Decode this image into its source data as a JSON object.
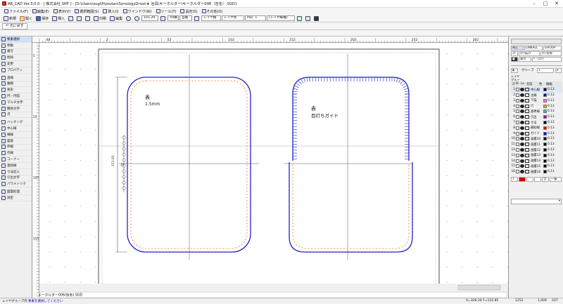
{
  "window": {
    "title": "AR_CAD Ver.3.0.0 - [ 株式会社 SHF ] - [D:\\Users\\sugi\\Hyoutan\\SynologyDrive\\★ 治具\\キーホルダー\\キーホルダー006（缶缶）.SGD]",
    "controls": [
      "–",
      "□",
      "✕"
    ]
  },
  "menubar": [
    {
      "label": "ファイル(F)",
      "icon": "file-icon"
    },
    {
      "label": "編集(E)",
      "icon": "edit-icon"
    },
    {
      "label": "表示(V)",
      "icon": "view-icon"
    },
    {
      "label": "選択範囲(S)",
      "icon": "select-icon"
    },
    {
      "label": "挿入(I)",
      "icon": "insert-icon"
    },
    {
      "label": "ウインドウ(W)",
      "icon": "window-icon"
    },
    {
      "label": "ツール(T)",
      "icon": "tool-icon"
    },
    {
      "label": "設定(S)",
      "icon": "settings-icon"
    },
    {
      "label": "その他(O)",
      "icon": "other-icon"
    }
  ],
  "toolbar": {
    "buttons": [
      "新規",
      "開く",
      "保存",
      "挿入",
      "印刷",
      "編集"
    ],
    "zoom": "101.29",
    "paper": "A4横",
    "mode": "自動",
    "layer_dropdown": "レイヤ幅",
    "color_dropdown": "レイヤ色",
    "pen_dropdown": "Pen. 1",
    "line_dropdown": "[レイヤ線種]"
  },
  "undo_label": "元に戻す",
  "leftpanel": [
    {
      "label": "要素選択",
      "icon": "cursor-icon",
      "selected": true
    },
    {
      "label": "移動",
      "icon": "move-icon"
    },
    {
      "label": "複写",
      "icon": "copy-icon"
    },
    {
      "label": "削除",
      "icon": "delete-icon"
    },
    {
      "label": "変更",
      "icon": "change-icon"
    },
    {
      "label": "プロパティ",
      "icon": "property-icon"
    },
    {
      "label": "直線",
      "icon": "line-icon"
    },
    {
      "label": "曲線",
      "icon": "curve-icon"
    },
    {
      "label": "矩形",
      "icon": "rect-icon"
    },
    {
      "label": "円・円弧",
      "icon": "circle-icon"
    },
    {
      "label": "マルチ文字",
      "icon": "multitext-icon"
    },
    {
      "label": "簡易文字",
      "icon": "text-icon"
    },
    {
      "label": "点",
      "icon": "point-icon"
    },
    {
      "label": "ハッチング",
      "icon": "hatch-icon"
    },
    {
      "label": "中心線",
      "icon": "centerline-icon"
    },
    {
      "label": "補線",
      "icon": "auxline-icon"
    },
    {
      "label": "面取",
      "icon": "chamfer-icon"
    },
    {
      "label": "伸縮",
      "icon": "stretch-icon"
    },
    {
      "label": "作線",
      "icon": "drawline-icon"
    },
    {
      "label": "コーナー",
      "icon": "corner-icon"
    },
    {
      "label": "連続線",
      "icon": "polyline-icon"
    },
    {
      "label": "寸法記入",
      "icon": "dimension-icon"
    },
    {
      "label": "引出文字",
      "icon": "leader-icon"
    },
    {
      "label": "パラメトリク",
      "icon": "parametric-icon"
    },
    {
      "label": "図面処理",
      "icon": "process-icon"
    },
    {
      "label": "測定",
      "icon": "measure-icon"
    }
  ],
  "rulers": {
    "h": [
      "-48",
      "2",
      "52",
      "102",
      "152",
      "202",
      "252",
      "302"
    ],
    "v": [
      "5",
      "55",
      "105",
      "155",
      "205"
    ]
  },
  "drawing": {
    "left_label_1": "表",
    "left_label_2": "1.5mm",
    "right_label_1": "表",
    "right_label_2": "目打ちガイド",
    "dim_height": "151.81",
    "dim_small": "35"
  },
  "filetab": "キーホルダー006(缶缶).SGD",
  "rightpanel": {
    "tabs": [
      "ALL",
      "LINKALL",
      "GROUP"
    ],
    "row2": [
      "ｽﾌﾟ",
      "ｴﾘｱ描ｽﾌﾟ",
      "ｴﾘｱ名称"
    ],
    "row3": [
      "表示",
      "ﾍﾞｰｽｴﾘｱ"
    ],
    "group_label": "グループ",
    "group_value": "1",
    "headers": [
      "ｽﾃ",
      "Di",
      "Lo",
      "名前",
      "色",
      "線幅"
    ],
    "layers": [
      {
        "n": "1",
        "name": "中心線",
        "color": "#000000",
        "w": "0.13"
      },
      {
        "n": "2",
        "name": "主線",
        "color": "#0000ff",
        "w": "0.13"
      },
      {
        "n": "3",
        "name": "下描",
        "color": "#ff66cc",
        "w": "0.13"
      },
      {
        "n": "4",
        "name": "穴",
        "color": "#ff9900",
        "w": "0.13"
      },
      {
        "n": "5",
        "name": "基準線",
        "color": "#00cccc",
        "w": "0.13"
      },
      {
        "n": "6",
        "name": "引出",
        "color": "#9900cc",
        "w": "0.13"
      },
      {
        "n": "7",
        "name": "寸法",
        "color": "#000000",
        "w": "0.13"
      },
      {
        "n": "8",
        "name": "補助線",
        "color": "#ff0000",
        "w": "0.13"
      },
      {
        "n": "9",
        "name": "ガイド",
        "color": "#0000ff",
        "w": "0.13"
      },
      {
        "n": "10",
        "name": "画層10",
        "color": "#000000",
        "w": "0.13"
      },
      {
        "n": "11",
        "name": "画層11",
        "color": "#000000",
        "w": "0.13"
      },
      {
        "n": "12",
        "name": "画層12",
        "color": "#000000",
        "w": "0.13"
      },
      {
        "n": "13",
        "name": "画層13",
        "color": "#000000",
        "w": "0.13"
      },
      {
        "n": "14",
        "name": "画層14",
        "color": "#000000",
        "w": "0.13"
      },
      {
        "n": "15",
        "name": "画層15",
        "color": "#000000",
        "w": "0.13"
      },
      {
        "n": "16",
        "name": "画層16",
        "color": "#000000",
        "w": "0.13"
      }
    ],
    "bottom_t": "T",
    "bottom_all": "全",
    "bottom_one": "一覧"
  },
  "statusbar": {
    "left": "レイヤグループ内",
    "hint": "要素を選択してください",
    "coords": "X=326.20    Y=122.85",
    "code": "1252",
    "zoom": "1,609",
    "num": "037"
  }
}
